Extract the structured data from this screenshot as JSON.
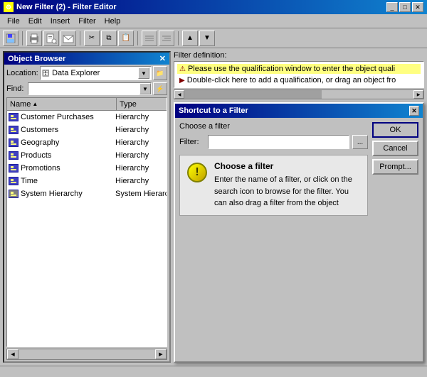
{
  "window": {
    "title": "New Filter (2) - Filter Editor"
  },
  "menu": {
    "items": [
      "File",
      "Edit",
      "Insert",
      "Filter",
      "Help"
    ]
  },
  "toolbar": {
    "buttons": [
      "save_close",
      "print",
      "print_preview",
      "email",
      "sep1",
      "cut",
      "copy",
      "paste",
      "sep2",
      "indent",
      "outdent",
      "sep3",
      "up",
      "down"
    ],
    "save_close_label": "Save and Close"
  },
  "object_browser": {
    "title": "Object Browser",
    "location_label": "Location:",
    "location_value": "Data Explorer",
    "find_label": "Find:",
    "find_placeholder": "",
    "columns": {
      "name": "Name",
      "type": "Type"
    },
    "items": [
      {
        "name": "Customer Purchases",
        "type": "Hierarchy",
        "selected": false
      },
      {
        "name": "Customers",
        "type": "Hierarchy",
        "selected": false
      },
      {
        "name": "Geography",
        "type": "Hierarchy",
        "selected": false
      },
      {
        "name": "Products",
        "type": "Hierarchy",
        "selected": false
      },
      {
        "name": "Promotions",
        "type": "Hierarchy",
        "selected": false
      },
      {
        "name": "Time",
        "type": "Hierarchy",
        "selected": false
      },
      {
        "name": "System Hierarchy",
        "type": "System Hierarch",
        "selected": false
      }
    ]
  },
  "filter_def": {
    "label": "Filter definition:",
    "line1": "Please use the qualification window to enter the object quali",
    "line2": "Double-click here to add a qualification, or drag an object fro"
  },
  "shortcut_dialog": {
    "title": "Shortcut to a Filter",
    "choose_filter_section": "Choose a filter",
    "filter_label": "Filter:",
    "filter_value": "",
    "browse_btn_label": "...",
    "ok_label": "OK",
    "cancel_label": "Cancel",
    "prompt_label": "Prompt...",
    "info_title": "Choose a filter",
    "info_text": "Enter the name of a filter, or click on the search icon to browse for the filter. You can also drag a filter from the object"
  }
}
